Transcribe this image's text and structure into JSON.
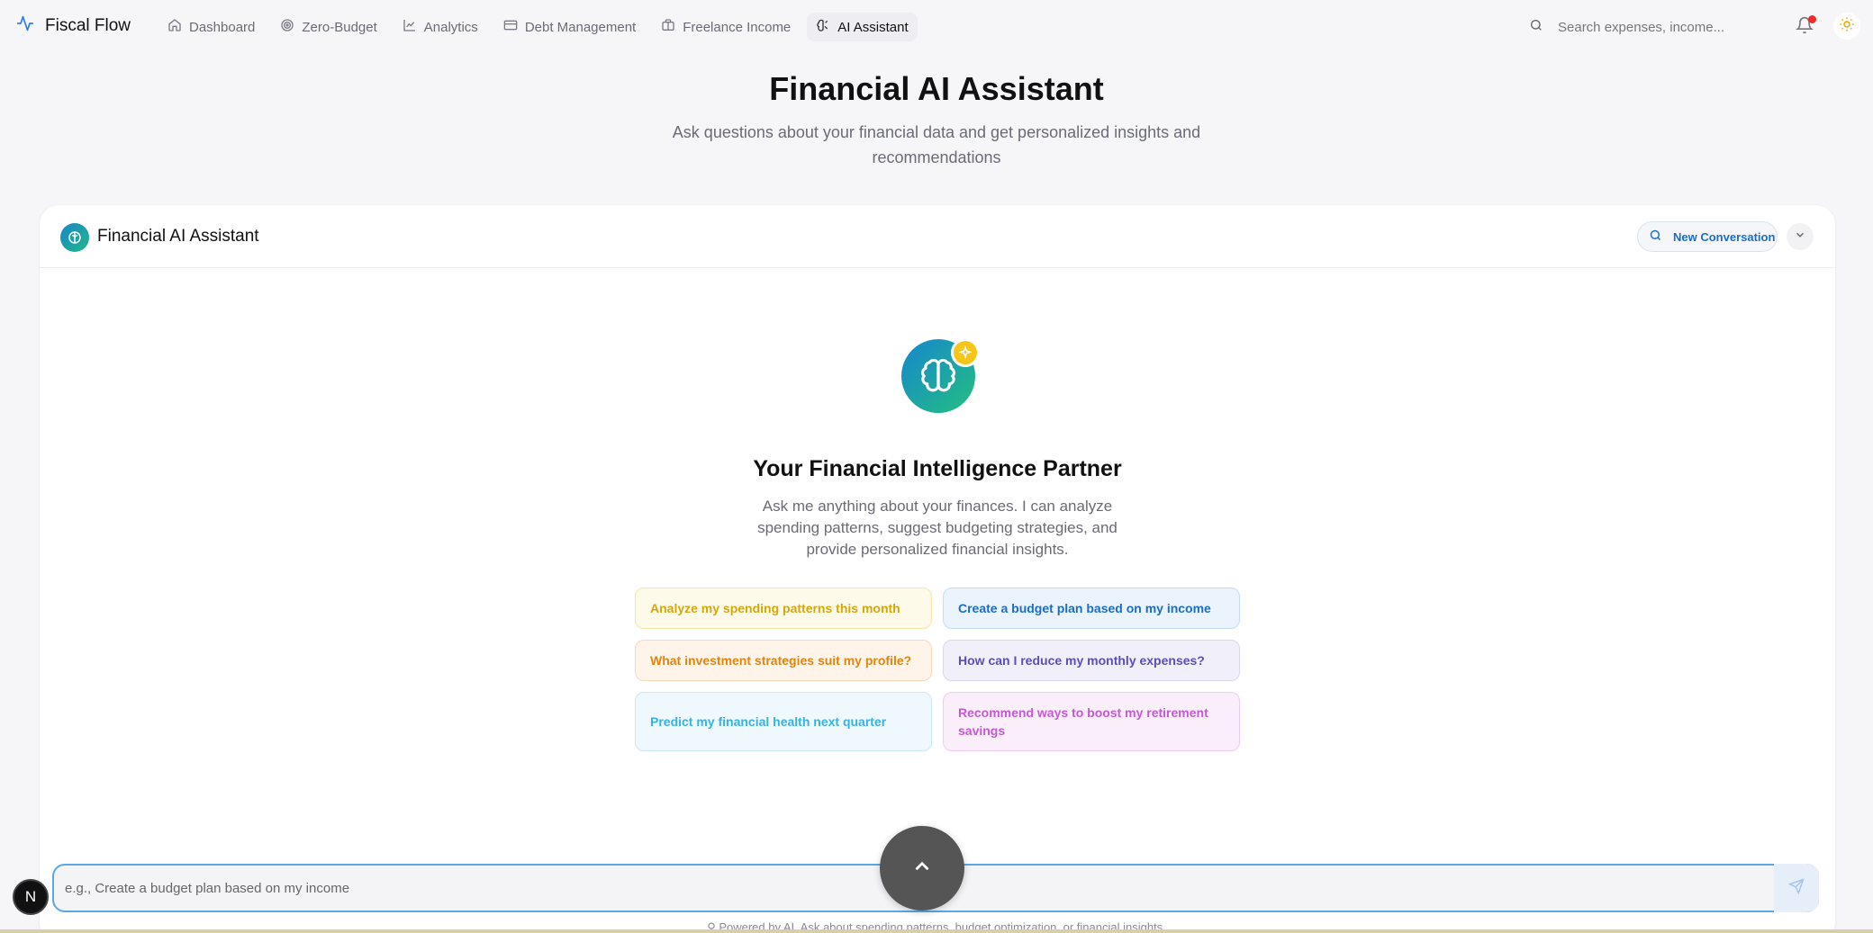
{
  "brand": {
    "name": "Fiscal Flow",
    "icon": "activity-icon"
  },
  "nav": [
    {
      "label": "Dashboard",
      "icon": "home-icon",
      "active": false
    },
    {
      "label": "Zero-Budget",
      "icon": "target-icon",
      "active": false
    },
    {
      "label": "Analytics",
      "icon": "line-chart-icon",
      "active": false
    },
    {
      "label": "Debt Management",
      "icon": "credit-card-icon",
      "active": false
    },
    {
      "label": "Freelance Income",
      "icon": "briefcase-icon",
      "active": false
    },
    {
      "label": "AI Assistant",
      "icon": "brain-icon",
      "active": true
    }
  ],
  "search": {
    "placeholder": "Search expenses, income..."
  },
  "notifications": {
    "has_unread": true,
    "dot_color": "#ef2b2b"
  },
  "page": {
    "title": "Financial AI Assistant",
    "subtitle": "Ask questions about your financial data and get personalized insights and recommendations"
  },
  "card": {
    "title": "Financial AI Assistant",
    "new_conversation_label": "New Conversation"
  },
  "hero": {
    "title": "Your Financial Intelligence Partner",
    "description": "Ask me anything about your finances. I can analyze spending patterns, suggest budgeting strategies, and provide personalized financial insights."
  },
  "suggestions": [
    {
      "label": "Analyze my spending patterns this month",
      "color": "#d4a70b"
    },
    {
      "label": "Create a budget plan based on my income",
      "color": "#1b6dc8"
    },
    {
      "label": "What investment strategies suit my profile?",
      "color": "#e0850e"
    },
    {
      "label": "How can I reduce my monthly expenses?",
      "color": "#5a4fb8"
    },
    {
      "label": "Predict my financial health next quarter",
      "color": "#36b3e0"
    },
    {
      "label": "Recommend ways to boost my retirement savings",
      "color": "#c25ad1"
    }
  ],
  "composer": {
    "placeholder": "e.g., Create a budget plan based on my income"
  },
  "footer_note": "Powered by AI. Ask about spending patterns, budget optimization, or financial insights.",
  "dev_badge": "N",
  "colors": {
    "accent": "#1b6dc8",
    "brand_gradient_start": "#1686cf",
    "brand_gradient_end": "#23bf7f"
  }
}
